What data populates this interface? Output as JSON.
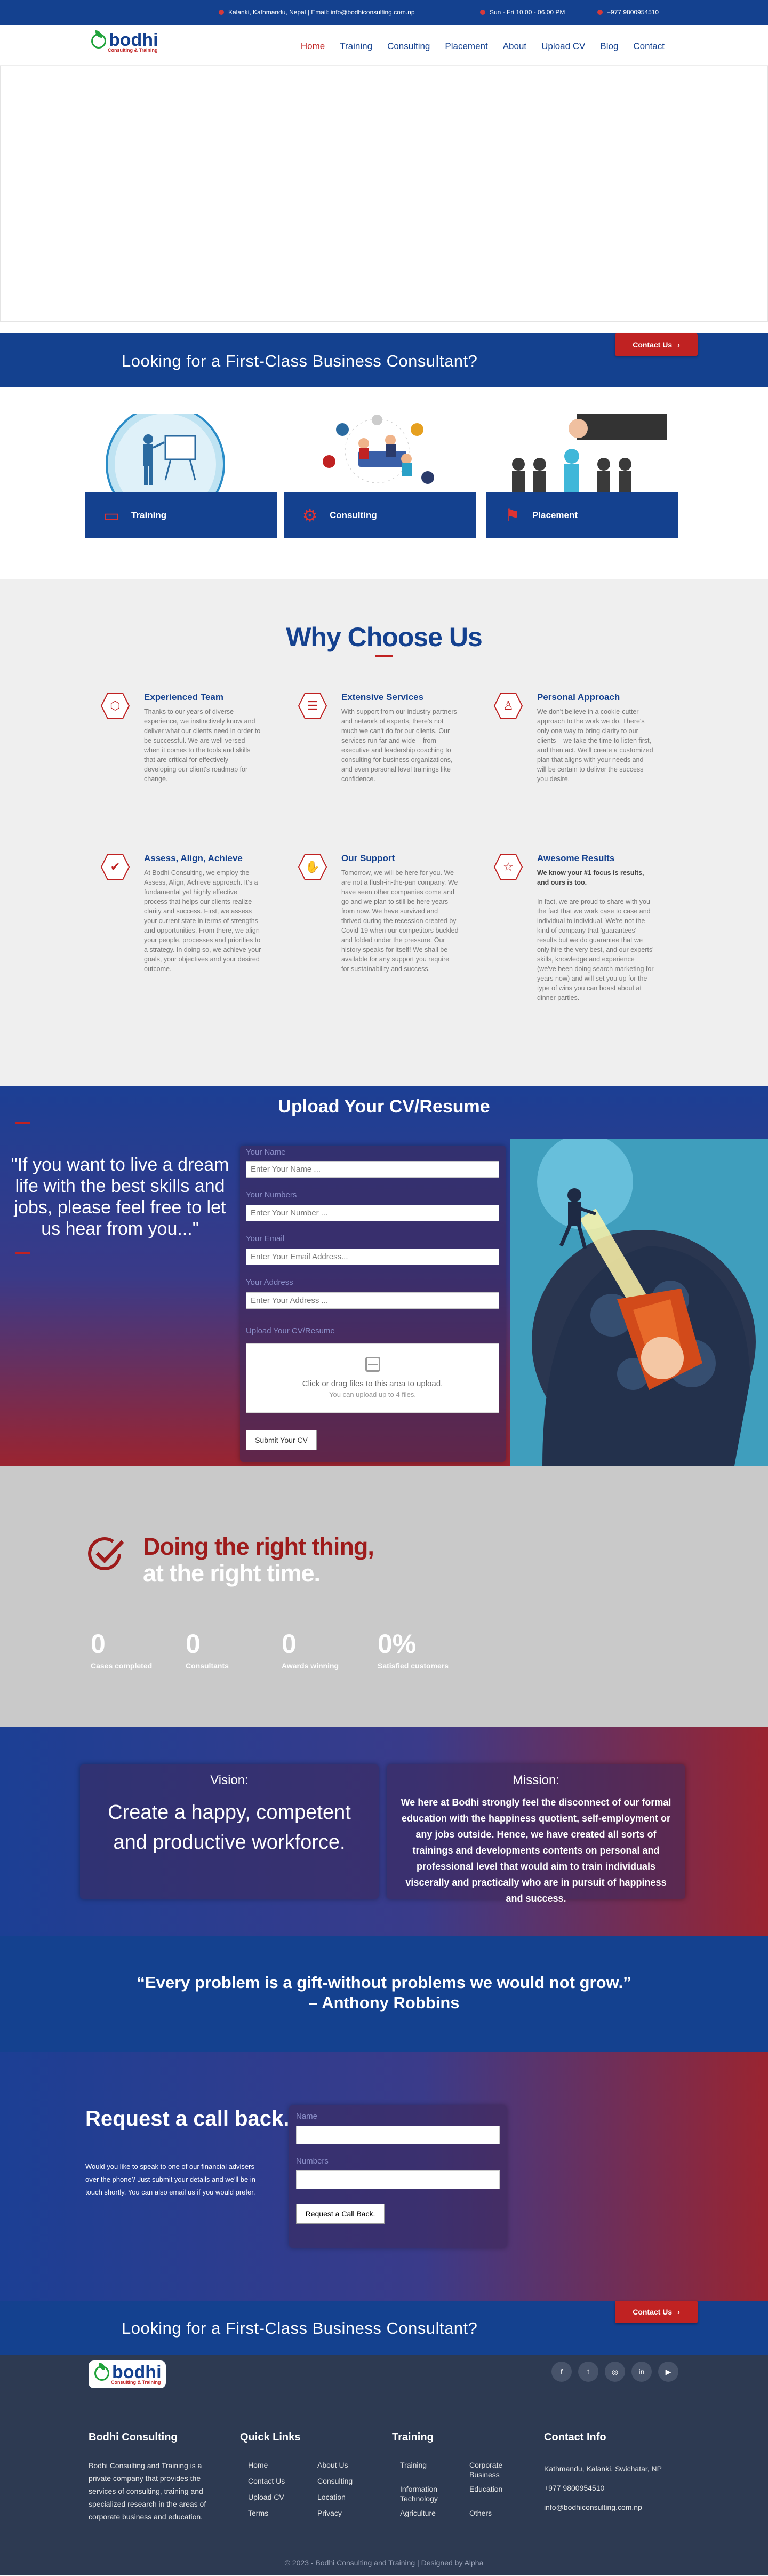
{
  "topbar": {
    "address": "Kalanki, Kathmandu, Nepal | Email: info@bodhiconsulting.com.np",
    "hours": "Sun - Fri 10.00 - 06.00 PM",
    "phone": "+977 9800954510"
  },
  "logo": {
    "word": "bodhi",
    "sub": "Consulting & Training"
  },
  "nav": {
    "items": [
      "Home",
      "Training",
      "Consulting",
      "Placement",
      "About",
      "Upload CV",
      "Blog",
      "Contact"
    ],
    "active": "Home"
  },
  "consult_banner": {
    "title": "Looking for a First-Class Business Consultant?",
    "button": "Contact Us",
    "button_icon": "chevron-right-icon"
  },
  "services": [
    {
      "label": "Training",
      "icon": "training-icon"
    },
    {
      "label": "Consulting",
      "icon": "consulting-icon"
    },
    {
      "label": "Placement",
      "icon": "placement-icon"
    }
  ],
  "why": {
    "title": "Why Choose Us",
    "features": [
      {
        "title": "Experienced Team",
        "icon": "team-icon",
        "text": "Thanks to our years of diverse experience, we instinctively know and deliver what our clients need in order to be successful. We are well-versed when it comes to the tools and skills that are critical for effectively developing our client's roadmap for change."
      },
      {
        "title": "Extensive Services",
        "icon": "list-icon",
        "text": "With support from our industry partners and network of experts, there's not much we can't do for our clients. Our services run far and wide – from executive and leadership coaching to consulting for business organizations, and even personal level trainings like confidence."
      },
      {
        "title": "Personal Approach",
        "icon": "user-icon",
        "text": "We don't believe in a cookie-cutter approach to the work we do. There's only one way to bring clarity to our clients – we take the time to listen first, and then act. We'll create a customized plan that aligns with your needs and will be certain to deliver the success you desire."
      },
      {
        "title": "Assess, Align, Achieve",
        "icon": "check-circle-icon",
        "text": "At Bodhi Consulting, we employ the Assess, Align, Achieve approach. It's a fundamental yet highly effective process that helps our clients realize clarity and success. First, we assess your current state in terms of strengths and opportunities. From there, we align your people, processes and priorities to a strategy. In doing so, we achieve your goals, your objectives and your desired outcome."
      },
      {
        "title": "Our Support",
        "icon": "handshake-icon",
        "text": "Tomorrow, we will be here for you. We are not a flush-in-the-pan company. We have seen other companies come and go and we plan to still be here years from now. We have survived and thrived during the recession created by Covid-19 when our competitors buckled and folded under the pressure. Our history speaks for itself! We shall be available for any support you require for sustainability and success."
      },
      {
        "title": "Awesome Results",
        "icon": "star-icon",
        "lead": "We know your #1 focus is results, and ours is too.",
        "text": "In fact, we are proud to share with you the fact that we work case to case and individual to individual. We're not the kind of company that 'guarantees' results but we do guarantee that we only hire the very best, and our experts' skills, knowledge and experience (we've been doing search marketing for years now) and will set you up for the type of wins you can boast about at dinner parties."
      }
    ]
  },
  "upload": {
    "title": "Upload Your CV/Resume",
    "quote": "\"If you want to live a dream life with the best skills and jobs, please feel free to let us hear from you...\"",
    "fields": [
      {
        "label": "Your Name",
        "placeholder": "Enter Your Name ..."
      },
      {
        "label": "Your Numbers",
        "placeholder": "Enter Your Number ..."
      },
      {
        "label": "Your Email",
        "placeholder": "Enter Your Email Address..."
      },
      {
        "label": "Your Address",
        "placeholder": "Enter Your Address ..."
      }
    ],
    "cv_label": "Upload Your CV/Resume",
    "drop_text": "Click or drag files to this area to upload.",
    "drop_sub": "You can upload up to 4 files.",
    "submit": "Submit Your CV"
  },
  "right_thing": {
    "title_line1": "Doing the right thing,",
    "title_line2": "at the right time.",
    "stats": [
      {
        "num": "0",
        "label": "Cases completed"
      },
      {
        "num": "0",
        "label": "Consultants"
      },
      {
        "num": "0",
        "label": "Awards winning"
      },
      {
        "num": "0%",
        "label": "Satisfied customers"
      }
    ]
  },
  "vision": {
    "heading": "Vision:",
    "text": "Create a happy, competent and productive workforce."
  },
  "mission": {
    "heading": "Mission:",
    "text": "We here at Bodhi strongly feel the disconnect of our formal education with the happiness quotient, self-employment or any jobs outside. Hence, we have created all sorts of trainings and developments contents on personal and professional level that would aim to train individuals viscerally and practically who are in pursuit of happiness and success."
  },
  "quote_strip": {
    "line1": "“Every problem is a gift-without problems we would not grow.”",
    "line2": "– Anthony Robbins"
  },
  "call": {
    "title": "Request a call back.",
    "text": "Would you like to speak to one of our financial advisers over the phone? Just submit your details and we'll be in touch shortly. You can also email us if you would prefer.",
    "name_label": "Name",
    "numbers_label": "Numbers",
    "button": "Request a Call Back."
  },
  "footer": {
    "social": [
      "facebook-icon",
      "twitter-icon",
      "instagram-icon",
      "linkedin-icon",
      "youtube-icon"
    ],
    "social_glyphs": [
      "f",
      "t",
      "◎",
      "in",
      "▶"
    ],
    "about": {
      "title": "Bodhi Consulting",
      "text": "Bodhi Consulting and Training is a private company that provides the services of consulting, training and specialized research in the areas of corporate business and education."
    },
    "quick_links": {
      "title": "Quick Links",
      "links": [
        "Home",
        "Contact Us",
        "Upload CV",
        "Terms",
        "About Us",
        "Consulting",
        "Location",
        "Privacy"
      ]
    },
    "training": {
      "title": "Training",
      "links": [
        "Training",
        "Information Technology",
        "Agriculture",
        "Corporate Business",
        "Education",
        "Others"
      ]
    },
    "contact": {
      "title": "Contact Info",
      "address": "Kathmandu, Kalanki, Swichatar, NP",
      "phone": "+977 9800954510",
      "email": "info@bodhiconsulting.com.np"
    },
    "copyright": "© 2023 - Bodhi Consulting and Training | Designed by Alpha"
  },
  "colors": {
    "primary": "#14418f",
    "accent": "#c02222",
    "footer": "#2d3a52"
  }
}
